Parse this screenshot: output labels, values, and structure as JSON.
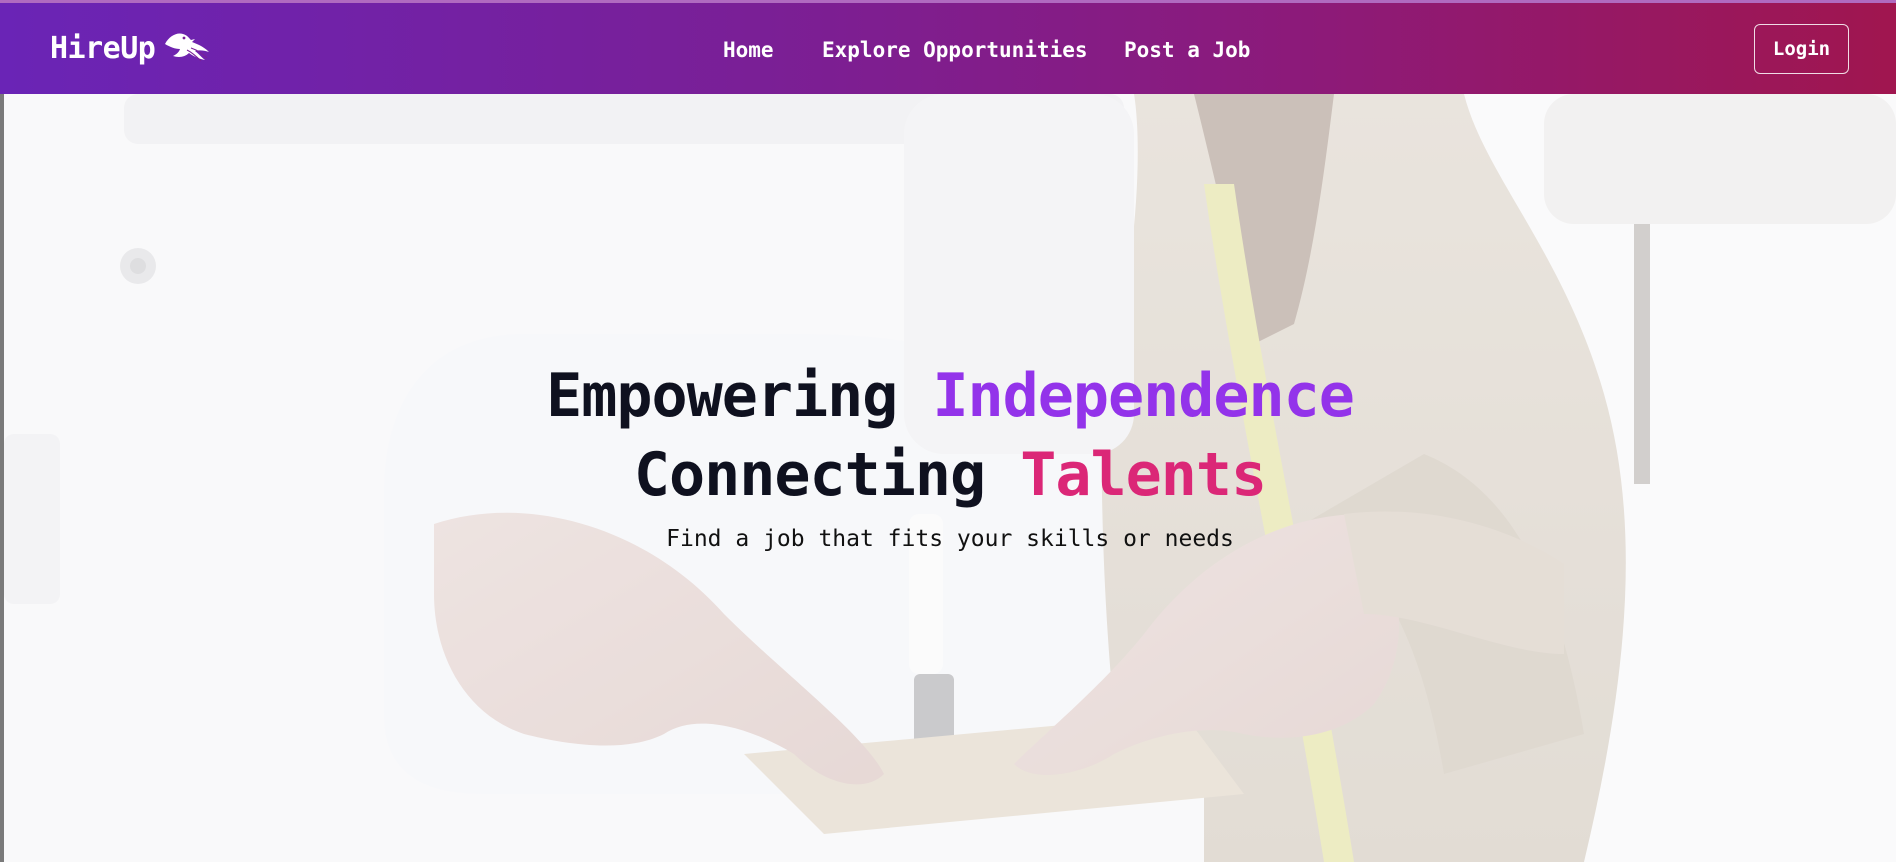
{
  "brand": {
    "name": "HireUp",
    "logo_icon": "bird-icon"
  },
  "nav": {
    "links": [
      {
        "label": "Home"
      },
      {
        "label": "Explore Opportunities"
      },
      {
        "label": "Post a Job"
      }
    ],
    "login_label": "Login"
  },
  "hero": {
    "line1_plain": "Empowering",
    "line1_accent": "Independence",
    "line2_plain": "Connecting",
    "line2_accent": "Talents",
    "subtitle": "Find a job that fits your skills or needs",
    "background_image": "sewing-machine-photo"
  },
  "colors": {
    "nav_gradient_start": "#6a24b6",
    "nav_gradient_end": "#a0164f",
    "accent_purple": "#9333ea",
    "accent_pink": "#db2777",
    "heading_dark": "#0f111f"
  }
}
